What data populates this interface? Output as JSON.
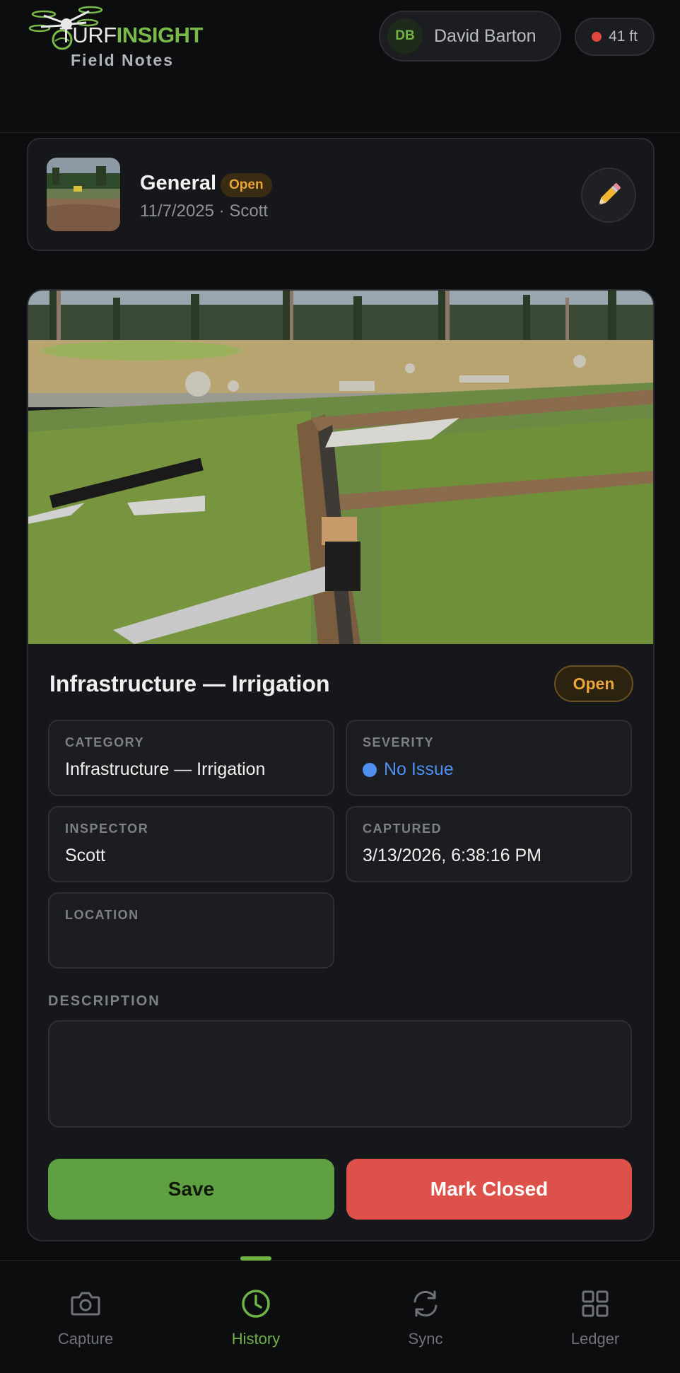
{
  "app": {
    "brand_part1": "TURF",
    "brand_part2": "INSIGHT",
    "subtitle": "Field Notes",
    "accent_color": "#6fb346"
  },
  "header": {
    "user_initials": "DB",
    "user_name": "David Barton",
    "altitude": "41 ft"
  },
  "summary": {
    "title": "General",
    "status": "Open",
    "meta": "11/7/2025 · Scott",
    "edit_icon": "pencil-icon"
  },
  "detail": {
    "title": "Infrastructure — Irrigation",
    "status": "Open",
    "fields": {
      "category_label": "CATEGORY",
      "category_value": "Infrastructure — Irrigation",
      "severity_label": "SEVERITY",
      "severity_value": "No Issue",
      "severity_color": "#4f8ff0",
      "inspector_label": "INSPECTOR",
      "inspector_value": "Scott",
      "captured_label": "CAPTURED",
      "captured_value": "3/13/2026, 6:38:16 PM",
      "location_label": "LOCATION",
      "location_value": ""
    },
    "description_label": "DESCRIPTION",
    "description_value": "",
    "save_label": "Save",
    "close_label": "Mark Closed"
  },
  "nav": {
    "items": [
      {
        "label": "Capture",
        "icon": "camera-icon"
      },
      {
        "label": "History",
        "icon": "clock-icon"
      },
      {
        "label": "Sync",
        "icon": "sync-icon"
      },
      {
        "label": "Ledger",
        "icon": "grid-icon"
      }
    ],
    "active": "History"
  }
}
